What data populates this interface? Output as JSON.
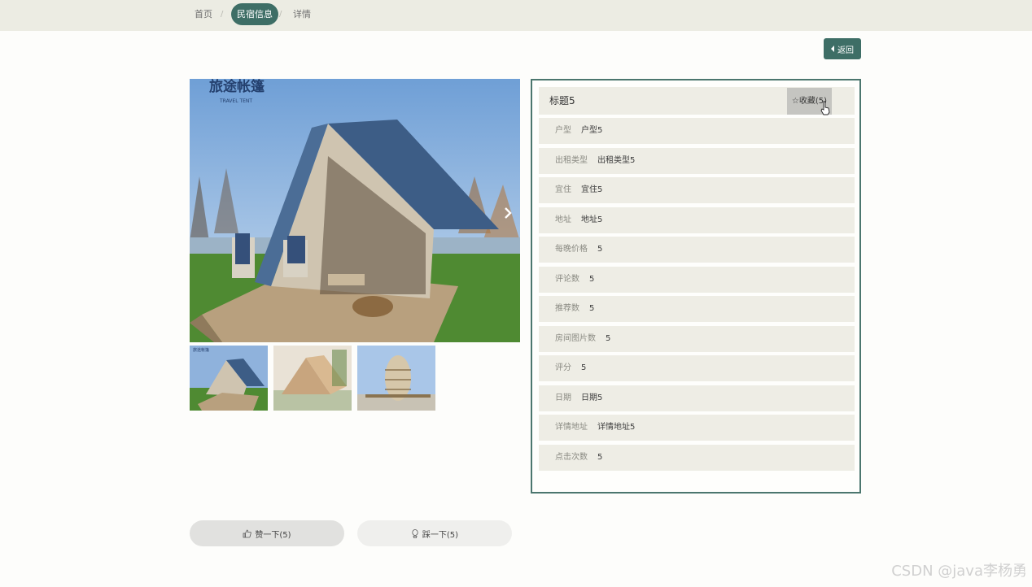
{
  "nav": {
    "items": [
      {
        "label": "首页"
      },
      {
        "label": "民宿信息"
      },
      {
        "label": "详情"
      }
    ],
    "separator": "/"
  },
  "back_button": {
    "label": "返回"
  },
  "gallery": {
    "brand_text": "旅途帐篷",
    "brand_sub": "TRAVEL TENT",
    "thumb_brand": "旅途帐篷"
  },
  "detail": {
    "title": "标题5",
    "favorite_label": "☆收藏(5)",
    "fields": [
      {
        "label": "户型",
        "value": "户型5"
      },
      {
        "label": "出租类型",
        "value": "出租类型5"
      },
      {
        "label": "宜住",
        "value": "宜住5"
      },
      {
        "label": "地址",
        "value": "地址5"
      },
      {
        "label": "每晚价格",
        "value": "5"
      },
      {
        "label": "评论数",
        "value": "5"
      },
      {
        "label": "推荐数",
        "value": "5"
      },
      {
        "label": "房间图片数",
        "value": "5"
      },
      {
        "label": "评分",
        "value": "5"
      },
      {
        "label": "日期",
        "value": "日期5"
      },
      {
        "label": "详情地址",
        "value": "详情地址5"
      },
      {
        "label": "点击次数",
        "value": "5"
      }
    ]
  },
  "votes": {
    "like_label": "赞一下(5)",
    "dislike_label": "踩一下(5)"
  },
  "watermark": "CSDN @java李杨勇",
  "colors": {
    "accent": "#3e6e66",
    "topbar": "#ecece3",
    "row_bg": "#eeede5"
  }
}
